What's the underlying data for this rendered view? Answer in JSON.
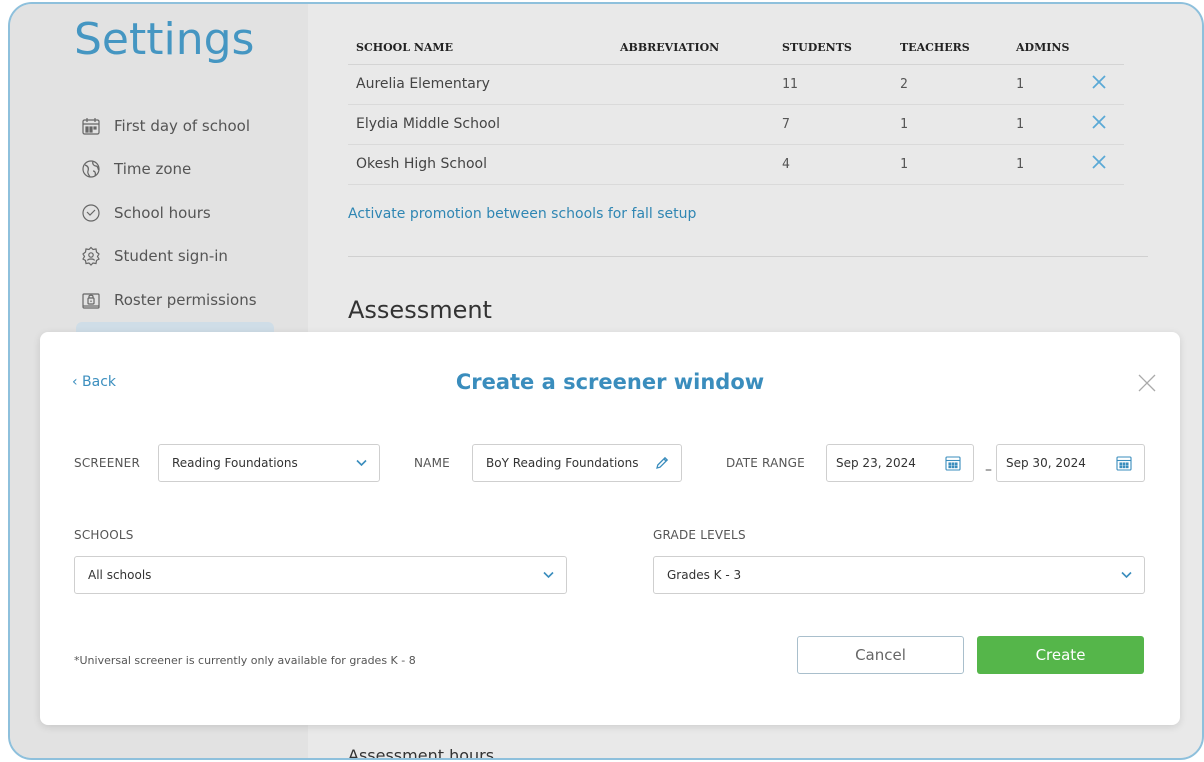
{
  "sidebar": {
    "title": "Settings",
    "items": [
      {
        "label": "First day of school",
        "icon": "calendar-icon"
      },
      {
        "label": "Time zone",
        "icon": "globe-icon"
      },
      {
        "label": "School hours",
        "icon": "clock-icon"
      },
      {
        "label": "Student sign-in",
        "icon": "gear-icon"
      },
      {
        "label": "Roster permissions",
        "icon": "lock-icon"
      }
    ]
  },
  "schools_table": {
    "headers": [
      "SCHOOL NAME",
      "ABBREVIATION",
      "STUDENTS",
      "TEACHERS",
      "ADMINS"
    ],
    "rows": [
      {
        "name": "Aurelia Elementary",
        "abbreviation": "",
        "students": "11",
        "teachers": "2",
        "admins": "1"
      },
      {
        "name": "Elydia Middle School",
        "abbreviation": "",
        "students": "7",
        "teachers": "1",
        "admins": "1"
      },
      {
        "name": "Okesh High School",
        "abbreviation": "",
        "students": "4",
        "teachers": "1",
        "admins": "1"
      }
    ]
  },
  "main": {
    "promo_link": "Activate promotion between schools for fall setup",
    "assessment_heading": "Assessment",
    "assessment_hours_heading": "Assessment hours"
  },
  "modal": {
    "back_label": "‹ Back",
    "title": "Create a screener window",
    "screener_label": "SCREENER",
    "screener_value": "Reading Foundations",
    "name_label": "NAME",
    "name_value": "BoY Reading Foundations",
    "date_range_label": "DATE RANGE",
    "date_start": "Sep 23, 2024",
    "date_separator": "–",
    "date_end": "Sep 30, 2024",
    "schools_label": "SCHOOLS",
    "schools_value": "All schools",
    "grade_levels_label": "GRADE LEVELS",
    "grade_levels_value": "Grades K - 3",
    "footnote": "*Universal screener is currently only available for grades K - 8",
    "cancel_label": "Cancel",
    "create_label": "Create"
  },
  "colors": {
    "accent": "#3a8dbd",
    "create_button": "#55b64a",
    "remove_x": "#5aa9d6"
  }
}
